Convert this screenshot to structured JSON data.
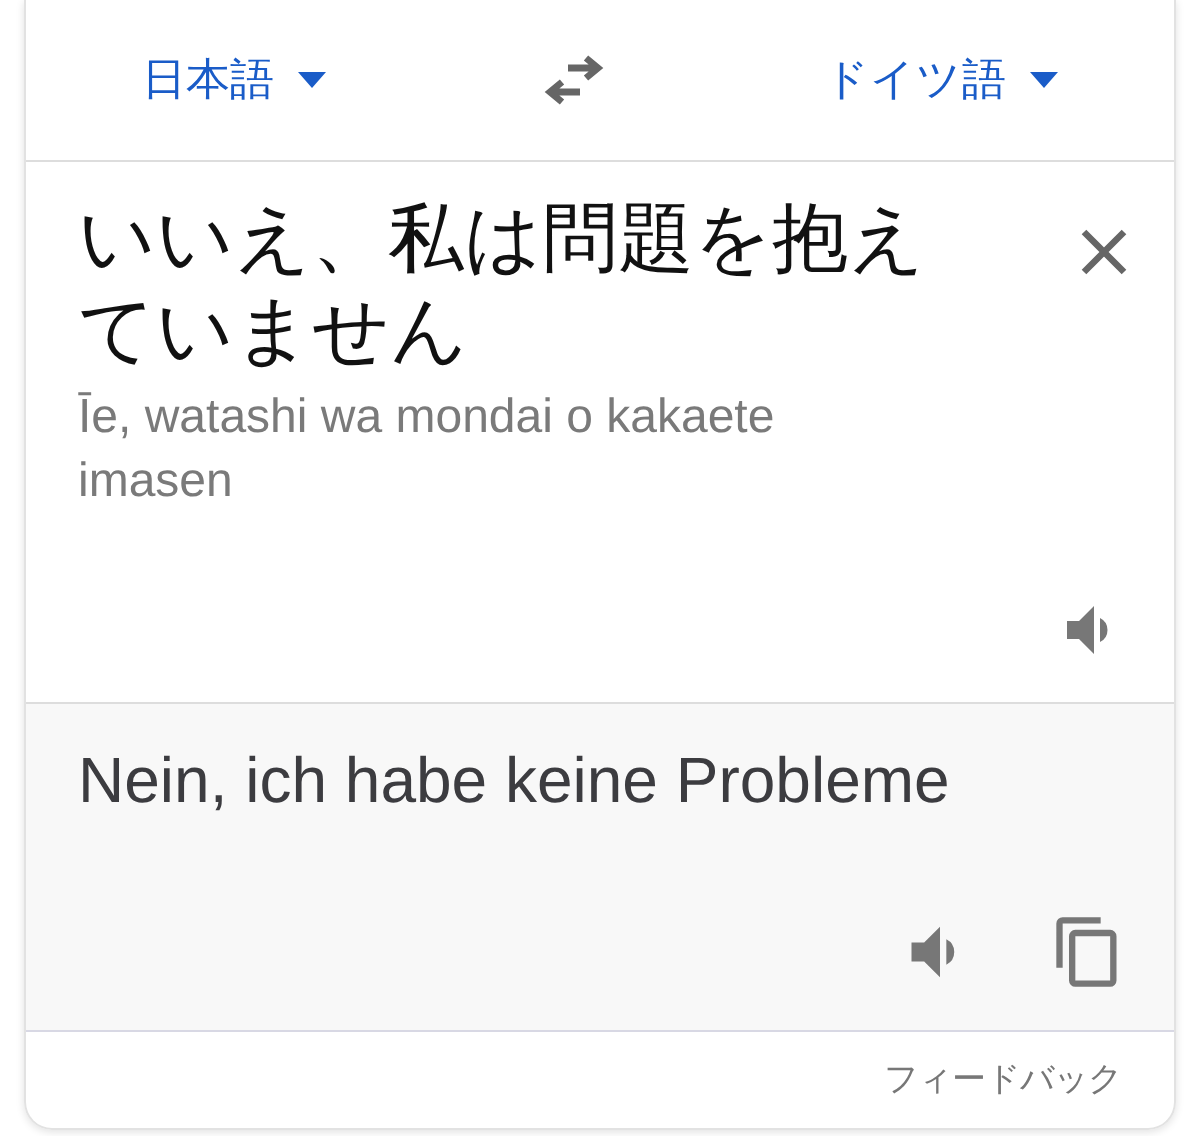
{
  "languages": {
    "source": "日本語",
    "target": "ドイツ語"
  },
  "source": {
    "text": "いいえ、私は問題を抱えていません",
    "romanization": "Īe, watashi wa mondai o kakaete imasen"
  },
  "translation": {
    "text": "Nein, ich habe keine Probleme"
  },
  "footer": {
    "feedback": "フィードバック"
  }
}
